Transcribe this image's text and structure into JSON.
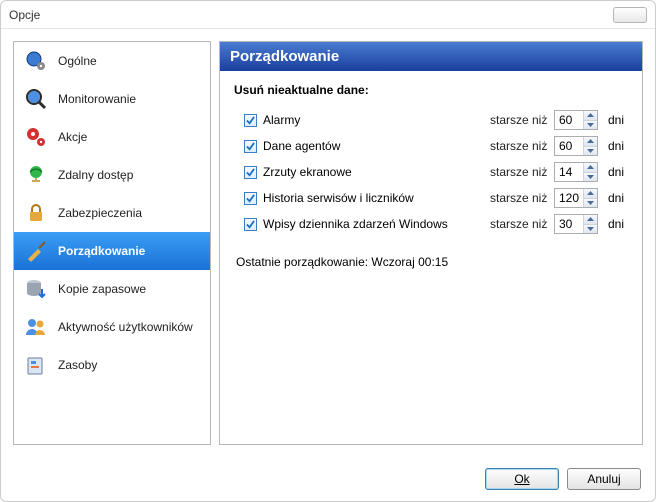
{
  "window": {
    "title": "Opcje"
  },
  "sidebar": {
    "items": [
      {
        "label": "Ogólne"
      },
      {
        "label": "Monitorowanie"
      },
      {
        "label": "Akcje"
      },
      {
        "label": "Zdalny dostęp"
      },
      {
        "label": "Zabezpieczenia"
      },
      {
        "label": "Porządkowanie"
      },
      {
        "label": "Kopie zapasowe"
      },
      {
        "label": "Aktywność użytkowników"
      },
      {
        "label": "Zasoby"
      }
    ]
  },
  "content": {
    "title": "Porządkowanie",
    "section_title": "Usuń nieaktualne dane:",
    "older_label": "starsze niż",
    "unit_label": "dni",
    "rows": [
      {
        "label": "Alarmy",
        "value": "60"
      },
      {
        "label": "Dane agentów",
        "value": "60"
      },
      {
        "label": "Zrzuty ekranowe",
        "value": "14"
      },
      {
        "label": "Historia serwisów i liczników",
        "value": "120"
      },
      {
        "label": "Wpisy dziennika zdarzeń Windows",
        "value": "30"
      }
    ],
    "status_prefix": "Ostatnie porządkowanie: ",
    "status_value": "Wczoraj 00:15"
  },
  "footer": {
    "ok": "Ok",
    "cancel": "Anuluj"
  }
}
